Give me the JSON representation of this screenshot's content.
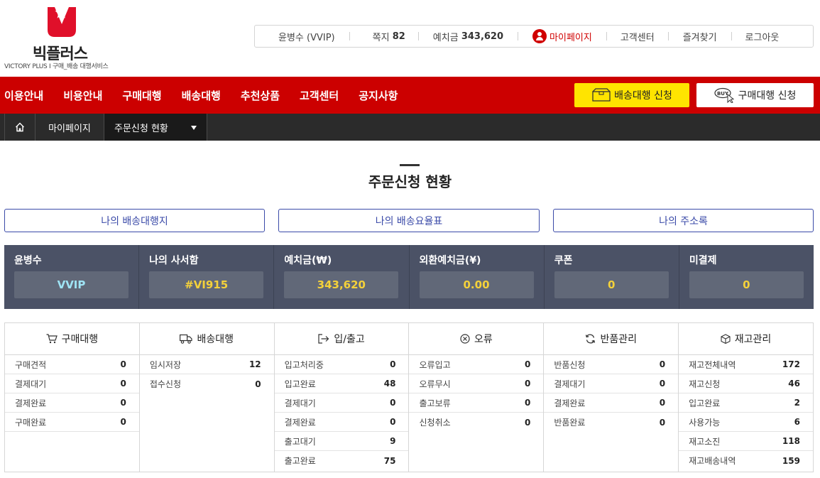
{
  "logo": {
    "name": "빅플러스",
    "sub": "VICTORY PLUS I 구매_배송 대행서비스"
  },
  "util": {
    "user_label": "윤병수 (VVIP)",
    "note_label": "쪽지",
    "note_count": "82",
    "deposit_label": "예치금",
    "deposit_value": "343,620",
    "mypage": "마이페이지",
    "support": "고객센터",
    "favorites": "즐겨찾기",
    "logout": "로그아웃"
  },
  "nav": {
    "items": [
      "이용안내",
      "비용안내",
      "구매대행",
      "배송대행",
      "추천상품",
      "고객센터",
      "공지사항"
    ],
    "ship_button": "배송대행 신청",
    "buy_button": "구매대행 신청",
    "buy_icon_text": "BUY"
  },
  "breadcrumb": {
    "mypage": "마이페이지",
    "current": "주문신청 현황"
  },
  "page_title": "주문신청 현황",
  "links": [
    "나의 배송대행지",
    "나의 배송요율표",
    "나의 주소록"
  ],
  "info": [
    {
      "label": "윤병수",
      "value": "VVIP"
    },
    {
      "label": "나의 사서함",
      "value": "#VI915"
    },
    {
      "label": "예치금(₩)",
      "value": "343,620"
    },
    {
      "label": "외환예치금(¥)",
      "value": "0.00"
    },
    {
      "label": "쿠폰",
      "value": "0"
    },
    {
      "label": "미결제",
      "value": "0"
    }
  ],
  "grid": [
    {
      "title": "구매대행",
      "icon": "cart-icon",
      "rows": [
        {
          "label": "구매견적",
          "value": "0"
        },
        {
          "label": "결제대기",
          "value": "0"
        },
        {
          "label": "결제완료",
          "value": "0"
        },
        {
          "label": "구매완료",
          "value": "0"
        }
      ]
    },
    {
      "title": "배송대행",
      "icon": "truck-icon",
      "rows": [
        {
          "label": "임시저장",
          "value": "12"
        },
        {
          "label": "접수신청",
          "value": "0"
        }
      ]
    },
    {
      "title": "입/출고",
      "icon": "inout-icon",
      "rows": [
        {
          "label": "입고처리중",
          "value": "0"
        },
        {
          "label": "입고완료",
          "value": "48"
        },
        {
          "label": "결제대기",
          "value": "0"
        },
        {
          "label": "결제완료",
          "value": "0"
        },
        {
          "label": "출고대기",
          "value": "9"
        },
        {
          "label": "출고완료",
          "value": "75"
        }
      ]
    },
    {
      "title": "오류",
      "icon": "error-icon",
      "rows": [
        {
          "label": "오류입고",
          "value": "0"
        },
        {
          "label": "오류무시",
          "value": "0"
        },
        {
          "label": "출고보류",
          "value": "0"
        },
        {
          "label": "신청취소",
          "value": "0"
        }
      ]
    },
    {
      "title": "반품관리",
      "icon": "refresh-icon",
      "rows": [
        {
          "label": "반품신청",
          "value": "0"
        },
        {
          "label": "결제대기",
          "value": "0"
        },
        {
          "label": "결제완료",
          "value": "0"
        },
        {
          "label": "반품완료",
          "value": "0"
        }
      ]
    },
    {
      "title": "재고관리",
      "icon": "box-icon",
      "rows": [
        {
          "label": "재고전체내역",
          "value": "172"
        },
        {
          "label": "재고신청",
          "value": "46"
        },
        {
          "label": "입고완료",
          "value": "2"
        },
        {
          "label": "사용가능",
          "value": "6"
        },
        {
          "label": "재고소진",
          "value": "118"
        },
        {
          "label": "재고배송내역",
          "value": "159"
        }
      ]
    }
  ]
}
